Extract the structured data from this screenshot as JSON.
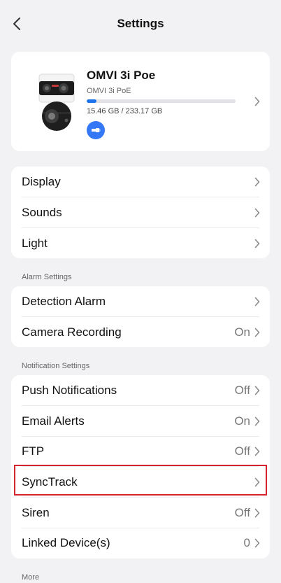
{
  "header": {
    "title": "Settings",
    "back_icon": "chevron-left-icon"
  },
  "device": {
    "name": "OMVI 3i Poe",
    "model": "OMVI 3i PoE",
    "storage_used": "15.46 GB",
    "storage_total": "233.17 GB",
    "storage_text": "15.46 GB / 233.17 GB",
    "storage_fraction": 0.066,
    "connection_icon": "ethernet-icon",
    "accent": "#1a73e8"
  },
  "group1": {
    "items": [
      {
        "label": "Display"
      },
      {
        "label": "Sounds"
      },
      {
        "label": "Light"
      }
    ]
  },
  "alarm": {
    "section_label": "Alarm Settings",
    "items": [
      {
        "label": "Detection Alarm",
        "value": ""
      },
      {
        "label": "Camera Recording",
        "value": "On"
      }
    ]
  },
  "notification": {
    "section_label": "Notification Settings",
    "items": [
      {
        "label": "Push Notifications",
        "value": "Off"
      },
      {
        "label": "Email Alerts",
        "value": "On"
      },
      {
        "label": "FTP",
        "value": "Off"
      },
      {
        "label": "SyncTrack",
        "value": ""
      },
      {
        "label": "Siren",
        "value": "Off"
      },
      {
        "label": "Linked Device(s)",
        "value": "0"
      }
    ]
  },
  "more": {
    "section_label": "More"
  },
  "highlight_color": "#d3262c"
}
